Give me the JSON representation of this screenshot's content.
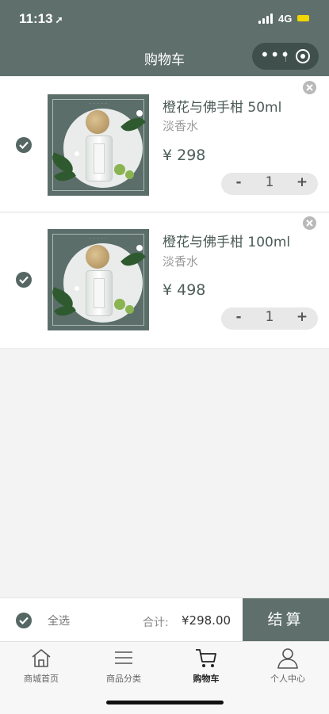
{
  "status": {
    "time": "11:13",
    "network": "4G"
  },
  "navbar": {
    "title": "购物车"
  },
  "cart": {
    "items": [
      {
        "name": "橙花与佛手柑 50ml",
        "subtitle": "淡香水",
        "price": "¥ 298",
        "quantity": "1",
        "selected": true
      },
      {
        "name": "橙花与佛手柑 100ml",
        "subtitle": "淡香水",
        "price": "¥ 498",
        "quantity": "1",
        "selected": true
      }
    ],
    "stepper": {
      "minus": "-",
      "plus": "+"
    }
  },
  "checkout": {
    "select_all": "全选",
    "total_label": "合计:",
    "total_value": "¥298.00",
    "pay": "结算"
  },
  "tabbar": {
    "items": [
      {
        "label": "商城首页",
        "icon": "home-icon"
      },
      {
        "label": "商品分类",
        "icon": "list-icon"
      },
      {
        "label": "购物车",
        "icon": "cart-icon",
        "active": true
      },
      {
        "label": "个人中心",
        "icon": "user-icon"
      }
    ]
  },
  "colors": {
    "theme": "#5f706c",
    "background": "#f3f3f3"
  }
}
